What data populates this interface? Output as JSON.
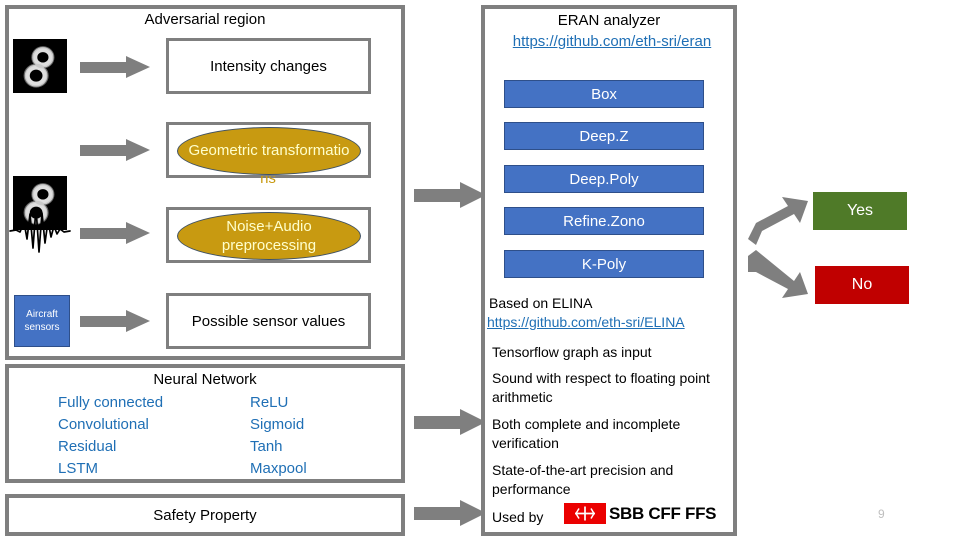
{
  "slide": {
    "page_number": "9"
  },
  "left_panel": {
    "title": "Adversarial region",
    "rows": [
      {
        "icon": "mnist-digit-8-image",
        "box_label": "Intensity changes",
        "box_kind": "plain"
      },
      {
        "icon": "mnist-digit-8-image",
        "box_label": "Geometric transformatio",
        "box_kind": "ellipse",
        "clipped_tail": "ns"
      },
      {
        "icon": "audio-waveform-image",
        "box_label": "Noise+Audio preprocessing",
        "box_kind": "ellipse"
      },
      {
        "icon": "aircraft-sensors-tile",
        "box_label": "Possible sensor values",
        "box_kind": "plain"
      }
    ],
    "aircraft_tile": {
      "line1": "Aircraft",
      "line2": "sensors"
    }
  },
  "neural_network_panel": {
    "title": "Neural Network",
    "layer_types": [
      "Fully connected",
      "Convolutional",
      "Residual",
      "LSTM"
    ],
    "activations": [
      "ReLU",
      "Sigmoid",
      "Tanh",
      "Maxpool"
    ]
  },
  "safety_panel": {
    "title": "Safety Property"
  },
  "eran_panel": {
    "title": "ERAN analyzer",
    "url": "https://github.com/eth-sri/eran",
    "domains": [
      "Box",
      "Deep.Z",
      "Deep.Poly",
      "Refine.Zono",
      "K-Poly"
    ],
    "based_on": "Based on ELINA",
    "based_on_url": "https://github.com/eth-sri/ELINA",
    "bullets": [
      "Tensorflow graph as input",
      "Sound with respect to floating point arithmetic",
      "Both complete and incomplete verification",
      "State-of-the-art precision and performance"
    ],
    "used_by_label": "Used by",
    "used_by_logo_text": "SBB CFF FFS"
  },
  "results": {
    "yes_label": "Yes",
    "no_label": "No"
  },
  "colors": {
    "frame_gray": "#7f7f7f",
    "arrow_gray": "#7f7f7f",
    "blue_box": "#4472C4",
    "blue_text": "#1F6FB5",
    "gold_ellipse": "#C89A11",
    "ellipse_text": "#FFFFCC",
    "yes_green": "#4F7A28",
    "no_red": "#C00000",
    "sbb_red": "#EB0000"
  },
  "icons": {
    "digit": "mnist-digit-8-icon",
    "wave": "audio-waveform-icon",
    "arrow": "right-arrow-icon",
    "sbb": "sbb-swiss-rail-icon"
  }
}
